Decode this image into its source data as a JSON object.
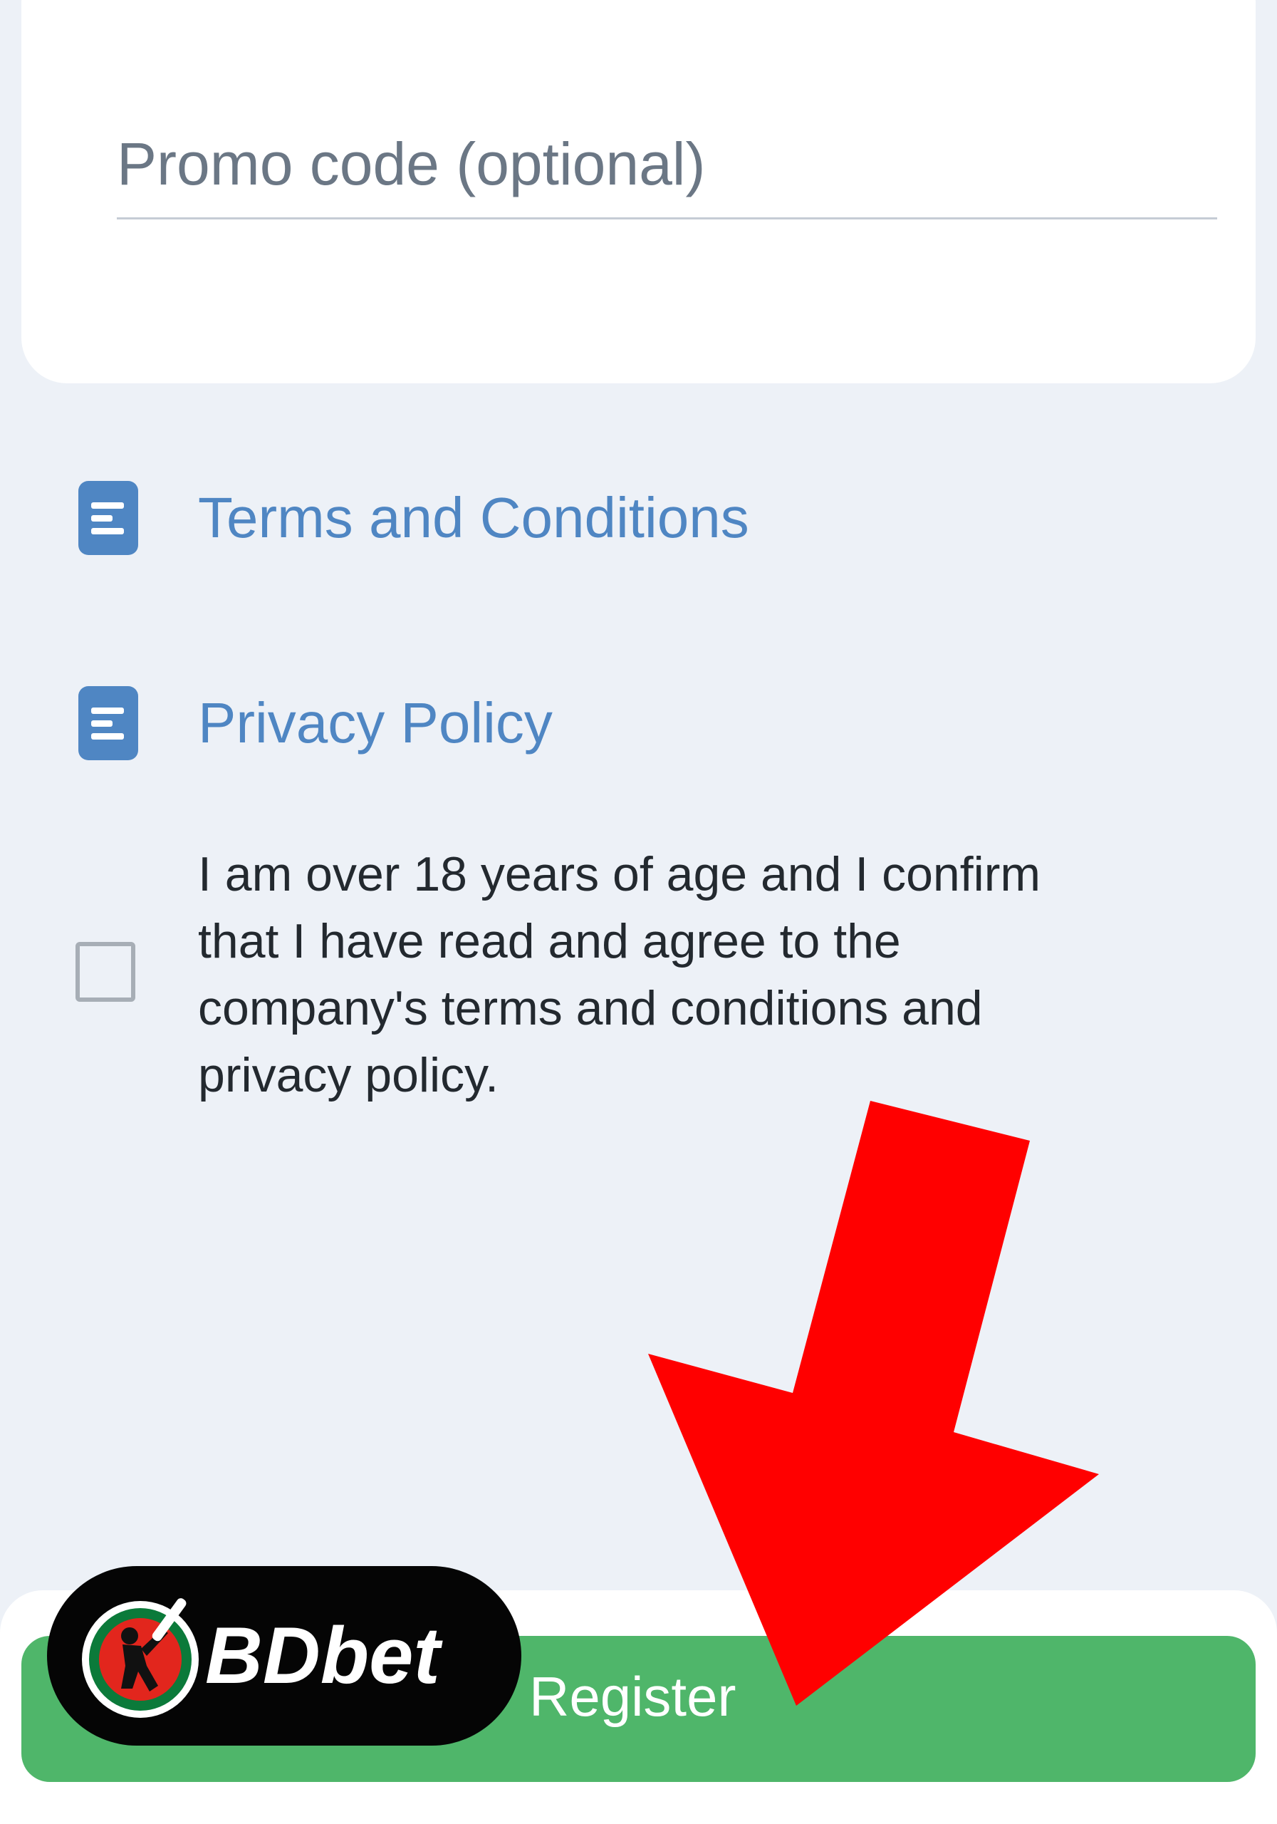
{
  "promo": {
    "placeholder": "Promo code (optional)"
  },
  "links": [
    {
      "label": "Terms and Conditions",
      "icon": "document-icon"
    },
    {
      "label": "Privacy Policy",
      "icon": "document-icon"
    }
  ],
  "consent": {
    "checked": false,
    "text": "I am over 18 years of age and I confirm that I have read and agree to the company's terms and conditions and privacy policy."
  },
  "register": {
    "label": "Register"
  },
  "logo": {
    "text": "BDbet"
  },
  "colors": {
    "background": "#edf1f7",
    "link": "#4f86c3",
    "button": "#4fb66a",
    "arrow": "#ff0000"
  }
}
